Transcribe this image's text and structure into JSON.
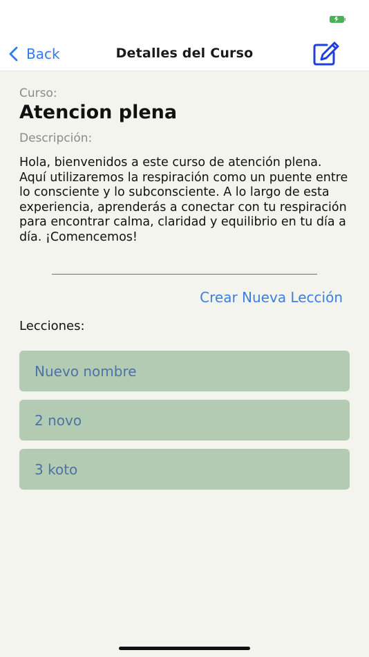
{
  "status": {
    "battery_color": "#45b356"
  },
  "nav": {
    "back_label": "Back",
    "title": "Detalles del Curso",
    "accent_color": "#2f7bea"
  },
  "course": {
    "name_label": "Curso:",
    "name": "Atencion plena",
    "description_label": "Descripción:",
    "description": "Hola, bienvenidos a este curso de atención plena. Aquí utilizaremos la respiración como un puente entre lo consciente y lo subconsciente. A lo largo de esta experiencia, aprenderás a conectar con tu respiración para encontrar calma, claridad y equilibrio en tu día a día. ¡Comencemos!"
  },
  "actions": {
    "new_lesson_label": "Crear Nueva Lección"
  },
  "lessons": {
    "heading": "Lecciones:",
    "items": [
      {
        "label": "Nuevo nombre"
      },
      {
        "label": "2 novo"
      },
      {
        "label": "3 koto"
      }
    ]
  }
}
